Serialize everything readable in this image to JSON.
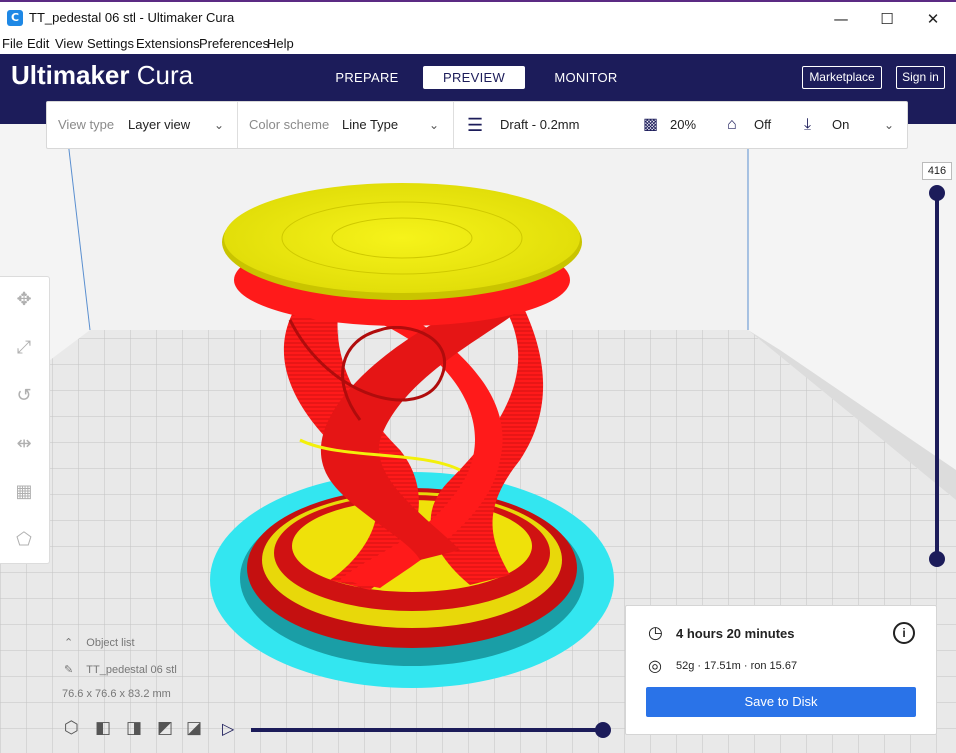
{
  "window": {
    "title": "TT_pedestal 06 stl - Ultimaker Cura",
    "app_icon": "C",
    "minimize": "—",
    "maximize": "☐",
    "close": "✕"
  },
  "menu": [
    "File",
    "Edit",
    "View",
    "Settings",
    "Extensions",
    "Preferences",
    "Help"
  ],
  "header": {
    "brand_bold": "Ultimaker",
    "brand_thin": "Cura",
    "tabs": [
      {
        "label": "PREPARE",
        "active": false
      },
      {
        "label": "PREVIEW",
        "active": true
      },
      {
        "label": "MONITOR",
        "active": false
      }
    ],
    "marketplace_label": "Marketplace",
    "signin_label": "Sign in"
  },
  "toolbar": {
    "view_type_label": "View type",
    "view_type_value": "Layer view",
    "color_scheme_label": "Color scheme",
    "color_scheme_value": "Line Type",
    "profile": "Draft - 0.2mm",
    "infill": "20%",
    "support": "Off",
    "adhesion": "On"
  },
  "layer_slider": {
    "current_layer": "416"
  },
  "objects": {
    "header": "Object list",
    "name": "TT_pedestal 06 stl",
    "dimensions": "76.6 x 76.6 x 83.2 mm"
  },
  "print_info": {
    "time": "4 hours 20 minutes",
    "material": "52g · 17.51m · ron 15.67",
    "save_label": "Save to Disk"
  },
  "colors": {
    "header_bg": "#1c1c5a",
    "accent_blue": "#2a73e8",
    "wall_red": "#ff1a1a",
    "top_yellow": "#f3f00b",
    "skirt_cyan": "#33e6f0"
  }
}
